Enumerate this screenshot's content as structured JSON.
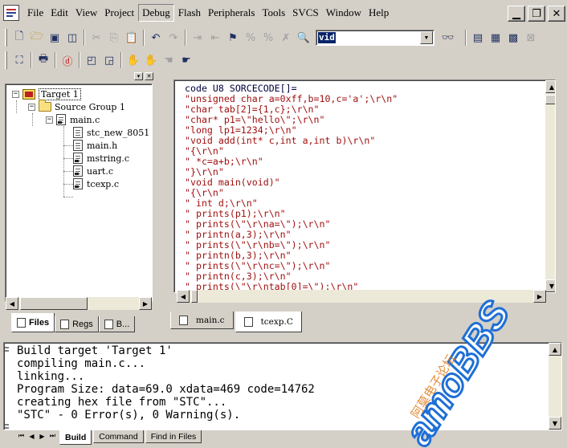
{
  "menu": {
    "items": [
      "File",
      "Edit",
      "View",
      "Project",
      "Debug",
      "Flash",
      "Peripherals",
      "Tools",
      "SVCS",
      "Window",
      "Help"
    ],
    "active": "Debug"
  },
  "window_buttons": {
    "minimize": "▁",
    "restore": "❐",
    "close": "✕"
  },
  "toolbar": {
    "find_value": "vid",
    "icons": [
      "new-file",
      "open",
      "save",
      "save-all",
      "cut",
      "copy",
      "paste",
      "undo",
      "redo",
      "indent",
      "unindent",
      "bookmark-set",
      "bookmark-next",
      "bookmark-prev",
      "bookmark-clear",
      "find",
      "find-combo",
      "binoculars",
      "batch-build",
      "build",
      "rebuild",
      "stop-build",
      "translate",
      "print",
      "debug",
      "window",
      "view",
      "hand",
      "hand-stop",
      "hand-grab",
      "hand-flag"
    ]
  },
  "project": {
    "target": "Target 1",
    "group": "Source Group 1",
    "main_file": "main.c",
    "files": [
      "stc_new_8051",
      "main.h",
      "mstring.c",
      "uart.c",
      "tcexp.c"
    ],
    "tabs": [
      {
        "label": "Files",
        "icon": "files-icon"
      },
      {
        "label": "Regs",
        "icon": "regs-icon"
      },
      {
        "label": "B...",
        "icon": "books-icon"
      }
    ]
  },
  "editor": {
    "lines": [
      "code U8 SORCECODE[]=",
      "\"unsigned char a=0xff,b=10,c='a';\\r\\n\"",
      "\"char tab[2]={1,c};\\r\\n\"",
      "\"char* p1=\\\"hello\\\";\\r\\n\"",
      "\"long lp1=1234;\\r\\n\"",
      "\"void add(int* c,int a,int b)\\r\\n\"",
      "\"{\\r\\n\"",
      "\" *c=a+b;\\r\\n\"",
      "\"}\\r\\n\"",
      "\"void main(void)\"",
      "\"{\\r\\n\"",
      "\" int d;\\r\\n\"",
      "\" prints(p1);\\r\\n\"",
      "\" prints(\\\"\\r\\na=\\\");\\r\\n\"",
      "\" printn(a,3);\\r\\n\"",
      "\" prints(\\\"\\r\\nb=\\\");\\r\\n\"",
      "\" printn(b,3);\\r\\n\"",
      "\" prints(\\\"\\r\\nc=\\\");\\r\\n\"",
      "\" printn(c,3);\\r\\n\"",
      "\" prints(\\\"\\r\\ntab[0]=\\\");\\r\\n\""
    ],
    "tabs": [
      {
        "label": "main.c",
        "active": false
      },
      {
        "label": "tcexp.C",
        "active": true
      }
    ]
  },
  "output": {
    "lines": [
      "Build target 'Target 1'",
      "compiling main.c...",
      "linking...",
      "Program Size: data=69.0 xdata=469 code=14762",
      "creating hex file from \"STC\"...",
      "\"STC\" - 0 Error(s), 0 Warning(s)."
    ],
    "tabs": [
      {
        "label": "Build",
        "active": true
      },
      {
        "label": "Command",
        "active": false
      },
      {
        "label": "Find in Files",
        "active": false
      }
    ]
  },
  "watermark": {
    "main": "amoBBS",
    "sub": "阿莫电子论坛"
  },
  "colors": {
    "code": "#a01010",
    "selection": "#0a246a",
    "watermark": "#1e6fd6",
    "watermark_sub": "#e07818"
  }
}
